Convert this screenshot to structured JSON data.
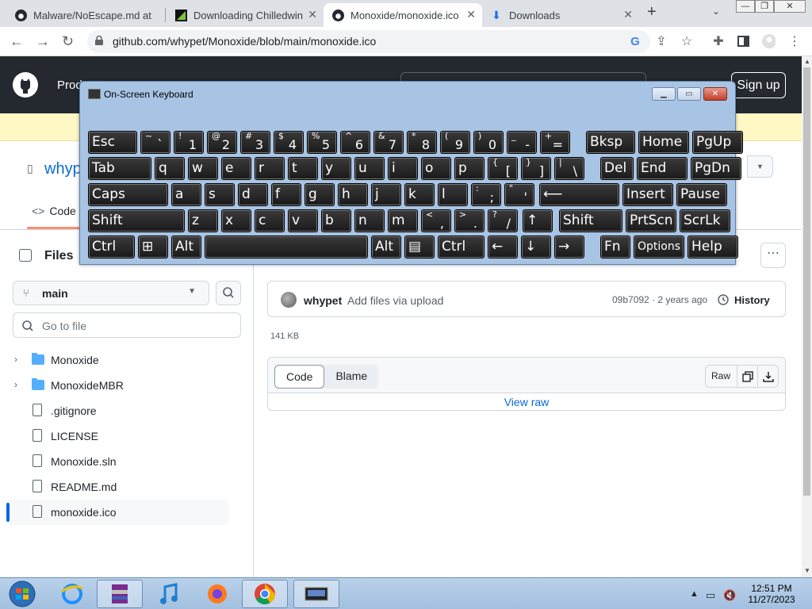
{
  "browser": {
    "tabs": [
      {
        "title": "Malware/NoEscape.md at"
      },
      {
        "title": "Downloading Chilledwin"
      },
      {
        "title": "Monoxide/monoxide.ico"
      },
      {
        "title": "Downloads"
      }
    ],
    "url": "github.com/whypet/Monoxide/blob/main/monoxide.ico"
  },
  "github": {
    "nav_product": "Product",
    "signup": "Sign up",
    "repo_owner": "whypet",
    "code_tab": "Code",
    "files_heading": "Files",
    "branch": "main",
    "goto_placeholder": "Go to file",
    "tree": [
      {
        "name": "Monoxide",
        "type": "folder"
      },
      {
        "name": "MonoxideMBR",
        "type": "folder"
      },
      {
        "name": ".gitignore",
        "type": "file"
      },
      {
        "name": "LICENSE",
        "type": "file"
      },
      {
        "name": "Monoxide.sln",
        "type": "file"
      },
      {
        "name": "README.md",
        "type": "file"
      },
      {
        "name": "monoxide.ico",
        "type": "file"
      }
    ],
    "commit": {
      "author": "whypet",
      "message": "Add files via upload",
      "sha_age": "09b7092 · 2 years ago",
      "history": "History"
    },
    "file_size": "141 KB",
    "code_btn": "Code",
    "blame_btn": "Blame",
    "raw_btn": "Raw",
    "view_raw": "View raw"
  },
  "osk": {
    "title": "On-Screen Keyboard",
    "rows": [
      [
        [
          "Esc",
          "",
          ""
        ],
        [
          "",
          "~",
          "`"
        ],
        [
          "",
          "!",
          "1"
        ],
        [
          "",
          "@",
          "2"
        ],
        [
          "",
          "#",
          "3"
        ],
        [
          "",
          "$",
          "4"
        ],
        [
          "",
          "%",
          "5"
        ],
        [
          "",
          "^",
          "6"
        ],
        [
          "",
          "&",
          "7"
        ],
        [
          "",
          "*",
          "8"
        ],
        [
          "",
          "(",
          "9"
        ],
        [
          "",
          ")",
          "0"
        ],
        [
          "",
          "_",
          "-"
        ],
        [
          "",
          "+",
          "="
        ],
        [
          "Bksp",
          "",
          ""
        ],
        [
          "Home",
          "",
          ""
        ],
        [
          "PgUp",
          "",
          ""
        ]
      ],
      [
        [
          "Tab",
          "",
          ""
        ],
        [
          "q",
          "",
          ""
        ],
        [
          "w",
          "",
          ""
        ],
        [
          "e",
          "",
          ""
        ],
        [
          "r",
          "",
          ""
        ],
        [
          "t",
          "",
          ""
        ],
        [
          "y",
          "",
          ""
        ],
        [
          "u",
          "",
          ""
        ],
        [
          "i",
          "",
          ""
        ],
        [
          "o",
          "",
          ""
        ],
        [
          "p",
          "",
          ""
        ],
        [
          "",
          "{",
          "["
        ],
        [
          "",
          "}",
          "]"
        ],
        [
          "",
          "|",
          "\\"
        ],
        [
          "Del",
          "",
          ""
        ],
        [
          "End",
          "",
          ""
        ],
        [
          "PgDn",
          "",
          ""
        ]
      ],
      [
        [
          "Caps",
          "",
          ""
        ],
        [
          "a",
          "",
          ""
        ],
        [
          "s",
          "",
          ""
        ],
        [
          "d",
          "",
          ""
        ],
        [
          "f",
          "",
          ""
        ],
        [
          "g",
          "",
          ""
        ],
        [
          "h",
          "",
          ""
        ],
        [
          "j",
          "",
          ""
        ],
        [
          "k",
          "",
          ""
        ],
        [
          "l",
          "",
          ""
        ],
        [
          "",
          ":",
          ";"
        ],
        [
          "",
          "\"",
          "'"
        ],
        [
          "⟵",
          "",
          ""
        ],
        [
          "Insert",
          "",
          ""
        ],
        [
          "Pause",
          "",
          ""
        ]
      ],
      [
        [
          "Shift",
          "",
          ""
        ],
        [
          "z",
          "",
          ""
        ],
        [
          "x",
          "",
          ""
        ],
        [
          "c",
          "",
          ""
        ],
        [
          "v",
          "",
          ""
        ],
        [
          "b",
          "",
          ""
        ],
        [
          "n",
          "",
          ""
        ],
        [
          "m",
          "",
          ""
        ],
        [
          "",
          "<",
          ","
        ],
        [
          "",
          ">",
          "."
        ],
        [
          "",
          "?",
          "/"
        ],
        [
          "↑",
          "",
          ""
        ],
        [
          "Shift",
          "",
          ""
        ],
        [
          "PrtScn",
          "",
          ""
        ],
        [
          "ScrLk",
          "",
          ""
        ]
      ],
      [
        [
          "Ctrl",
          "",
          ""
        ],
        [
          "⊞",
          "",
          ""
        ],
        [
          "Alt",
          "",
          ""
        ],
        [
          "",
          "",
          ""
        ],
        [
          "Alt",
          "",
          ""
        ],
        [
          "▤",
          "",
          ""
        ],
        [
          "Ctrl",
          "",
          ""
        ],
        [
          "←",
          "",
          ""
        ],
        [
          "↓",
          "",
          ""
        ],
        [
          "→",
          "",
          ""
        ],
        [
          "Fn",
          "",
          ""
        ],
        [
          "Options",
          "",
          ""
        ],
        [
          "Help",
          "",
          ""
        ]
      ]
    ]
  },
  "taskbar": {
    "time": "12:51 PM",
    "date": "11/27/2023"
  },
  "colors": {
    "gh_header": "#24292f",
    "link": "#0969da",
    "banner": "#fff8c5",
    "osk_frame": "#a8c4e4"
  }
}
